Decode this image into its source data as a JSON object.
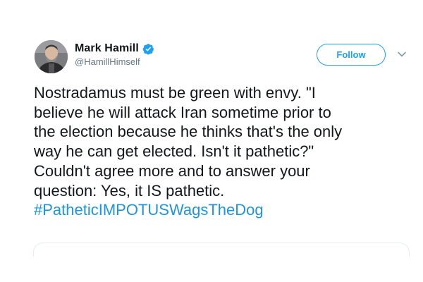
{
  "tweet": {
    "author": {
      "display_name": "Mark Hamill",
      "handle": "@HamillHimself",
      "verified_icon": "verified-badge-icon",
      "avatar_icon": "avatar-photo"
    },
    "follow_label": "Follow",
    "menu_icon": "chevron-down-icon",
    "text_lines": [
      "Nostradamus must be green with envy. \"I",
      "believe he will attack Iran sometime prior to",
      "the election because he thinks that's the only",
      "way he can get elected. Isn't it pathetic?\"",
      "Couldn't agree more and to answer your",
      "question: Yes, it IS pathetic."
    ],
    "hashtag": "#PatheticIMPOTUSWagsTheDog"
  },
  "colors": {
    "brand_blue": "#1da1f2",
    "link_blue": "#1b95e0",
    "text": "#14171a",
    "secondary_text": "#657786",
    "border": "#e6ecf0"
  }
}
